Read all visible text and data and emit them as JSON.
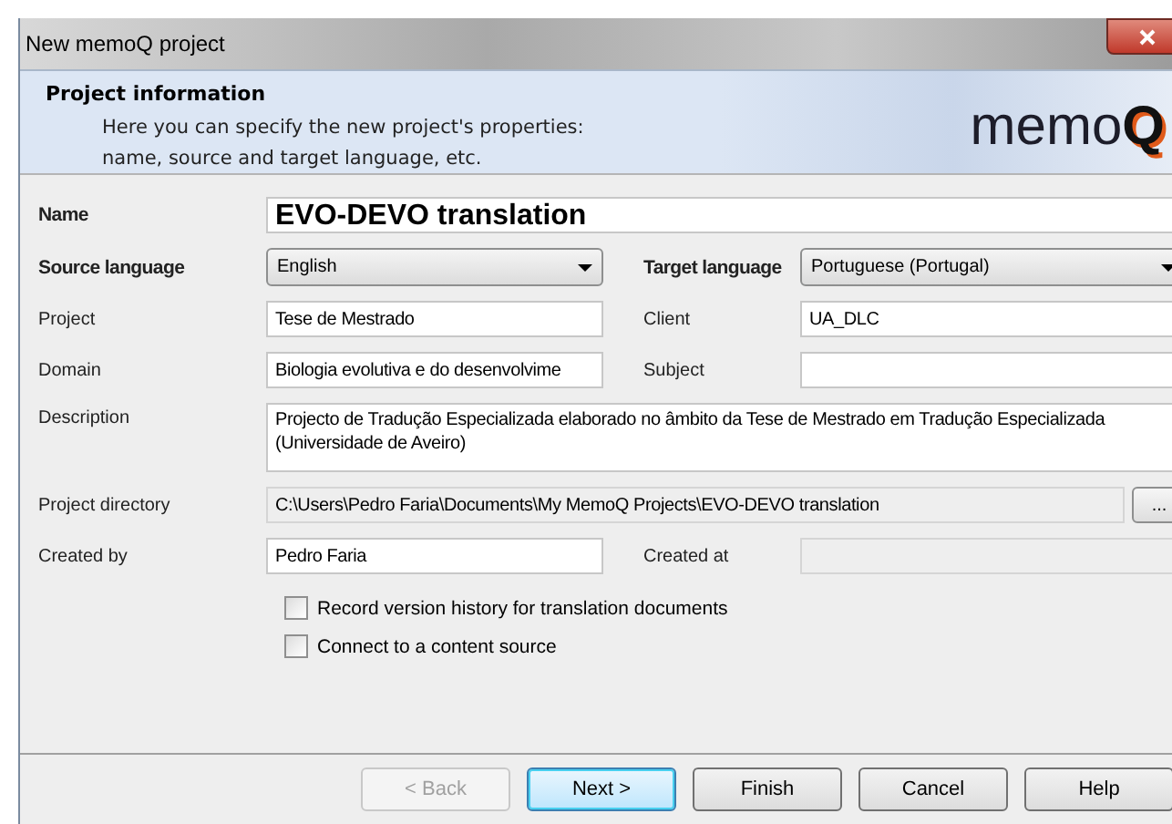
{
  "window": {
    "title": "New memoQ project"
  },
  "header": {
    "title": "Project information",
    "description": "Here you can specify the new project's properties:\nname, source and target language, etc.",
    "logo": {
      "text": "memo",
      "mark": "Q"
    }
  },
  "name": {
    "label": "Name",
    "value": "EVO-DEVO translation"
  },
  "source_language": {
    "label": "Source language",
    "value": "English"
  },
  "target_language": {
    "label": "Target language",
    "value": "Portuguese (Portugal)"
  },
  "project": {
    "label": "Project",
    "value": "Tese de Mestrado"
  },
  "client": {
    "label": "Client",
    "value": "UA_DLC"
  },
  "domain": {
    "label": "Domain",
    "value": "Biologia evolutiva e do desenvolvime"
  },
  "subject": {
    "label": "Subject"
  },
  "description": {
    "label": "Description",
    "value": "Projecto de Tradução Especializada elaborado no âmbito da Tese de Mestrado em Tradução Especializada (Universidade de Aveiro)"
  },
  "project_directory": {
    "label": "Project directory",
    "value": "C:\\Users\\Pedro Faria\\Documents\\My MemoQ Projects\\EVO-DEVO translation",
    "browse": "..."
  },
  "created_by": {
    "label": "Created by",
    "value": "Pedro Faria"
  },
  "created_at": {
    "label": "Created at",
    "disabled": true
  },
  "options": [
    {
      "label": "Record version history for translation documents",
      "checked": false
    },
    {
      "label": "Connect to a content source",
      "checked": false
    }
  ],
  "buttons": [
    {
      "label": "< Back",
      "disabled": true,
      "default": false
    },
    {
      "label": "Next >",
      "disabled": false,
      "default": true
    },
    {
      "label": "Finish",
      "disabled": false,
      "default": false
    },
    {
      "label": "Cancel",
      "disabled": false,
      "default": false
    },
    {
      "label": "Help",
      "disabled": false,
      "default": false
    }
  ]
}
